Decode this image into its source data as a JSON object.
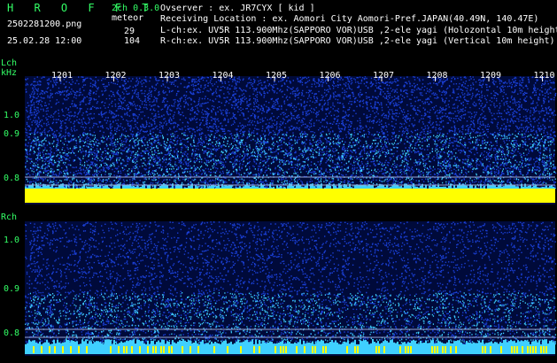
{
  "header": {
    "app_name": "H R O F F T",
    "mode": "2ch 0.3.0",
    "filename": "2502281200.png",
    "meteor_label": "meteor",
    "datetime": "25.02.28 12:00",
    "lch_count": "29",
    "rch_count": "104",
    "observer": "Ovserver              : ex. JR7CYX [ kid ]",
    "location": "Receiving Location : ex. Aomori City Aomori-Pref.JAPAN(40.49N, 140.47E)",
    "lch_info": "L-ch:ex. UV5R 113.900Mhz(SAPPORO VOR)USB ,2-ele yagi (Holozontal 10m height)",
    "rch_info": "R-ch:ex. UV5R 113.900Mhz(SAPPORO VOR)USB ,2-ele yagi (Vertical 10m height)"
  },
  "lch": {
    "label": "Lch",
    "unit": "kHz",
    "y_ticks": [
      "1.0",
      "0.9",
      "0.8"
    ]
  },
  "rch": {
    "label": "Rch",
    "y_ticks": [
      "1.0",
      "0.9",
      "0.8"
    ]
  },
  "time_axis": [
    "1201",
    "1202",
    "1203",
    "1204",
    "1205",
    "1206",
    "1207",
    "1208",
    "1209",
    "1210"
  ],
  "colors": {
    "noise": "#1a3fd6",
    "signal": "#3fd0ff",
    "strong": "#ffff00",
    "label": "#33ff66"
  }
}
